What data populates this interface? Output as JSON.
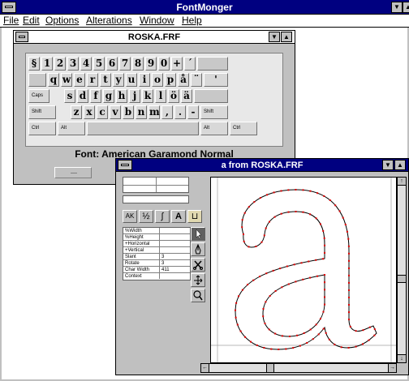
{
  "app": {
    "title": "FontMonger",
    "menu": [
      "File",
      "Edit",
      "Options",
      "Alterations",
      "Window",
      "Help"
    ]
  },
  "keyboard_window": {
    "title": "ROSKA.FRF",
    "font_label": "Font: American Garamond Normal",
    "row1": [
      "§",
      "1",
      "2",
      "3",
      "4",
      "5",
      "6",
      "7",
      "8",
      "9",
      "0",
      "+",
      "´",
      ""
    ],
    "row2": [
      "",
      "q",
      "w",
      "e",
      "r",
      "t",
      "y",
      "u",
      "i",
      "o",
      "p",
      "å",
      "¨",
      "'"
    ],
    "row3": [
      "Caps",
      "",
      "s",
      "d",
      "f",
      "g",
      "h",
      "j",
      "k",
      "l",
      "ö",
      "ä",
      ""
    ],
    "row4": [
      "Shift",
      "",
      "z",
      "x",
      "c",
      "v",
      "b",
      "n",
      "m",
      ",",
      ".",
      "-",
      "Shift"
    ],
    "row5": [
      "Ctrl",
      "Alt",
      "",
      "Alt",
      "Ctrl"
    ]
  },
  "glyph_window": {
    "title": "a from ROSKA.FRF",
    "glyph": "a",
    "tool_buttons": [
      "AK",
      "½",
      "∫",
      "A",
      "⊔"
    ],
    "metrics": [
      {
        "label": "%Width",
        "value": ""
      },
      {
        "label": "%Height",
        "value": ""
      },
      {
        "label": "+Horizontal",
        "value": ""
      },
      {
        "label": "+Vertical",
        "value": ""
      },
      {
        "label": "Slant",
        "value": "3"
      },
      {
        "label": "Rotate",
        "value": "3"
      },
      {
        "label": "Char Width",
        "value": "411"
      },
      {
        "label": "Context",
        "value": ""
      }
    ],
    "tools": [
      "pointer-tool",
      "pen-tool",
      "cut-tool",
      "move-tool",
      "zoom-tool"
    ]
  },
  "colors": {
    "active_title": "#000080",
    "face": "#c0c0c0",
    "point": "#e00000"
  }
}
